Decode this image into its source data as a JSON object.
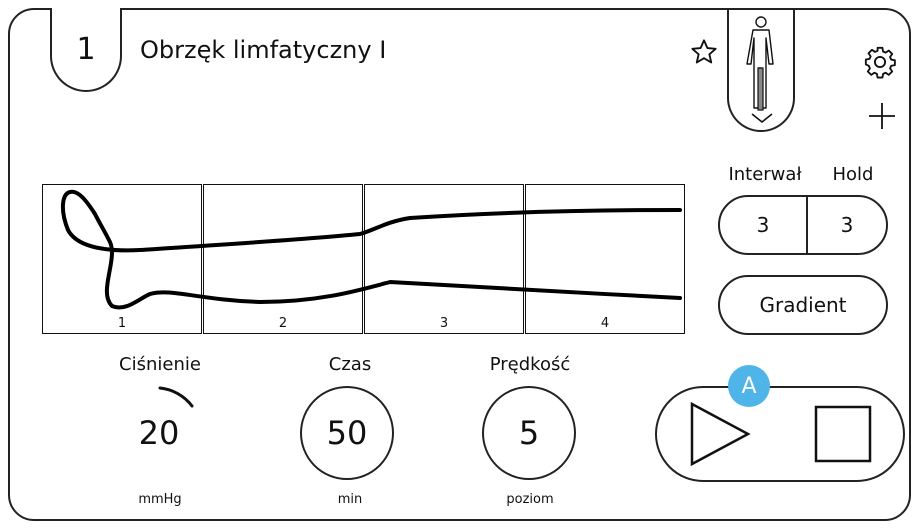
{
  "program": {
    "number": "1",
    "title": "Obrzęk limfatyczny I"
  },
  "icons": {
    "favorite": "star-outline-icon",
    "settings": "gear-icon",
    "add": "plus-icon",
    "body": "body-figure-icon",
    "expand": "chevron-down-icon"
  },
  "segments": [
    {
      "label": "1"
    },
    {
      "label": "2"
    },
    {
      "label": "3"
    },
    {
      "label": "4"
    }
  ],
  "interval": {
    "label": "Interwał",
    "value": "3"
  },
  "hold": {
    "label": "Hold",
    "value": "3"
  },
  "gradient": {
    "label": "Gradient"
  },
  "pressure": {
    "label": "Ciśnienie",
    "value": "20",
    "unit": "mmHg"
  },
  "time": {
    "label": "Czas",
    "value": "50",
    "unit": "min"
  },
  "speed": {
    "label": "Prędkość",
    "value": "5",
    "unit": "poziom"
  },
  "badge": {
    "text": "A",
    "color": "#4fb4e8"
  },
  "controls": {
    "play": "play-icon",
    "stop": "stop-icon"
  }
}
